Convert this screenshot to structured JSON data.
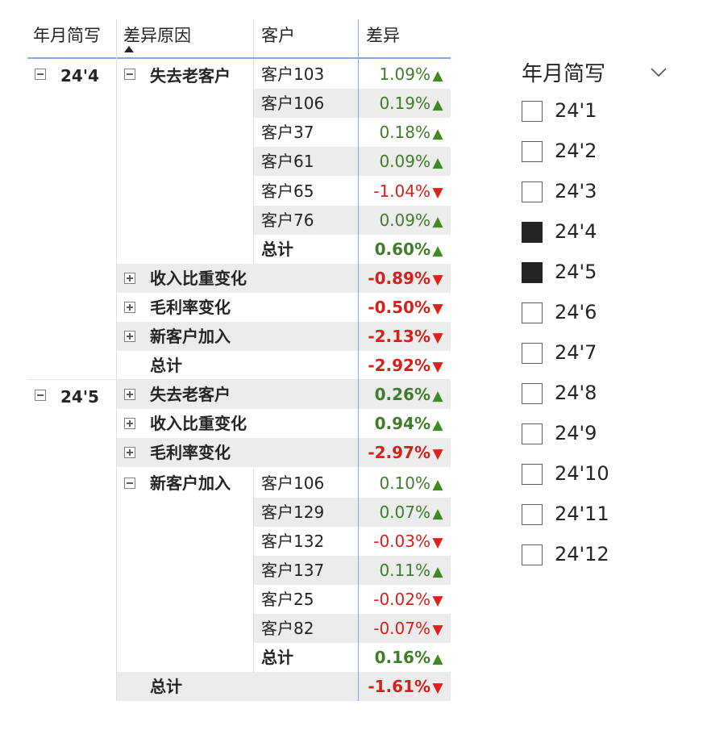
{
  "matrix": {
    "headers": {
      "period": "年月简写",
      "reason": "差异原因",
      "customer": "客户",
      "diff": "差异"
    },
    "groups": {
      "g244": {
        "period": "24'4",
        "lost": {
          "label": "失去老客户",
          "rows": [
            {
              "customer": "客户103",
              "value": "1.09%",
              "trend": "up"
            },
            {
              "customer": "客户106",
              "value": "0.19%",
              "trend": "up"
            },
            {
              "customer": "客户37",
              "value": "0.18%",
              "trend": "up"
            },
            {
              "customer": "客户61",
              "value": "0.09%",
              "trend": "up"
            },
            {
              "customer": "客户65",
              "value": "-1.04%",
              "trend": "down"
            },
            {
              "customer": "客户76",
              "value": "0.09%",
              "trend": "up"
            }
          ],
          "subtotal_label": "总计",
          "subtotal": "0.60%",
          "subtotal_trend": "up"
        },
        "reasons": [
          {
            "label": "收入比重变化",
            "value": "-0.89%",
            "trend": "down"
          },
          {
            "label": "毛利率变化",
            "value": "-0.50%",
            "trend": "down"
          },
          {
            "label": "新客户加入",
            "value": "-2.13%",
            "trend": "down"
          }
        ],
        "total_label": "总计",
        "total": "-2.92%",
        "total_trend": "down"
      },
      "g245": {
        "period": "24'5",
        "reasons": [
          {
            "label": "失去老客户",
            "value": "0.26%",
            "trend": "up"
          },
          {
            "label": "收入比重变化",
            "value": "0.94%",
            "trend": "up"
          },
          {
            "label": "毛利率变化",
            "value": "-2.97%",
            "trend": "down"
          }
        ],
        "newcust": {
          "label": "新客户加入",
          "rows": [
            {
              "customer": "客户106",
              "value": "0.10%",
              "trend": "up"
            },
            {
              "customer": "客户129",
              "value": "0.07%",
              "trend": "up"
            },
            {
              "customer": "客户132",
              "value": "-0.03%",
              "trend": "down"
            },
            {
              "customer": "客户137",
              "value": "0.11%",
              "trend": "up"
            },
            {
              "customer": "客户25",
              "value": "-0.02%",
              "trend": "down"
            },
            {
              "customer": "客户82",
              "value": "-0.07%",
              "trend": "down"
            }
          ],
          "subtotal_label": "总计",
          "subtotal": "0.16%",
          "subtotal_trend": "up"
        }
      }
    },
    "grand_total_label": "总计",
    "grand_total": "-1.61%",
    "grand_total_trend": "down",
    "colors": {
      "positive": "#3f7d2a",
      "negative": "#d6201c",
      "band": "#ececec",
      "accent_line": "#8aa8e0"
    },
    "icons": {
      "expanded": "minus-square-icon",
      "collapsed": "plus-square-icon",
      "up": "triangle-up-icon",
      "down": "triangle-down-icon",
      "sort": "sort-ascending-icon"
    }
  },
  "slicer": {
    "title": "年月简写",
    "options": [
      {
        "label": "24'1",
        "checked": false
      },
      {
        "label": "24'2",
        "checked": false
      },
      {
        "label": "24'3",
        "checked": false
      },
      {
        "label": "24'4",
        "checked": true
      },
      {
        "label": "24'5",
        "checked": true
      },
      {
        "label": "24'6",
        "checked": false
      },
      {
        "label": "24'7",
        "checked": false
      },
      {
        "label": "24'8",
        "checked": false
      },
      {
        "label": "24'9",
        "checked": false
      },
      {
        "label": "24'10",
        "checked": false
      },
      {
        "label": "24'11",
        "checked": false
      },
      {
        "label": "24'12",
        "checked": false
      }
    ]
  }
}
